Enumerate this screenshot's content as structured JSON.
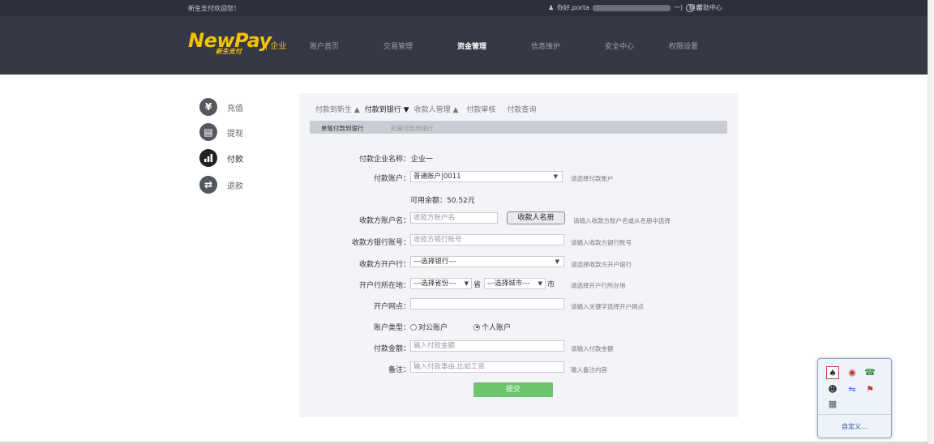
{
  "header": {
    "welcome": "新生支付欢迎您！",
    "greeting": "你好,porta",
    "user_suffix": "一)",
    "logout": "退出",
    "help": "帮助中心",
    "logo_text": "NewPay",
    "logo_sub": "新生支付",
    "enterprise": "| 企业",
    "nav": [
      "账户首页",
      "交易管理",
      "资金管理",
      "信息维护",
      "安全中心",
      "权限设置"
    ],
    "active_nav": "资金管理"
  },
  "sidebar": {
    "items": [
      {
        "label": "充值",
        "icon": "yen-icon"
      },
      {
        "label": "提现",
        "icon": "withdraw-icon"
      },
      {
        "label": "付款",
        "icon": "bar-chart-icon"
      },
      {
        "label": "退款",
        "icon": "refund-icon"
      }
    ],
    "active": "付款"
  },
  "tabs": {
    "items": [
      "付款到新生 ▲",
      "付款到银行 ▼",
      "收款人管理 ▲",
      "付款审核",
      "付款查询"
    ],
    "active": "付款到银行 ▼"
  },
  "subtabs": {
    "single": "单笔付款到银行",
    "batch": "批量付款到银行"
  },
  "form": {
    "company_label": "付款企业名称：",
    "company_value": "企业一",
    "account_label": "付款账户：",
    "account_value": "普通账户|0011",
    "account_hint": "请选择付款账户",
    "balance_label": "可用余额：",
    "balance_value": "50.52元",
    "payee_name_label": "收款方账户名：",
    "payee_name_placeholder": "收款方账户名",
    "payee_book_button": "收款人名册",
    "payee_name_hint": "请输入收款方账户名或从名册中选择",
    "bank_acct_label": "收款方银行账号：",
    "bank_acct_placeholder": "收款方银行账号",
    "bank_acct_hint": "请输入收款方银行账号",
    "bank_label": "收款方开户行：",
    "bank_value": "---选择银行---",
    "bank_hint": "请选择收款方开户银行",
    "location_label": "开户行所在地：",
    "province_value": "---选择省份---",
    "province_unit": "省",
    "city_value": "---选择城市---",
    "city_unit": "市",
    "location_hint": "请选择开户行所在地",
    "branch_label": "开户网点：",
    "branch_hint": "请输入关键字选择开户网点",
    "acct_type_label": "账户类型：",
    "acct_type_public": "对公账户",
    "acct_type_private": "个人账户",
    "amount_label": "付款金额：",
    "amount_placeholder": "输入付款金额",
    "amount_hint": "请输入付款金额",
    "memo_label": "备注：",
    "memo_placeholder": "输入付款事由,比如工资",
    "memo_hint": "输入备注内容",
    "submit": "提交"
  },
  "tray": {
    "customize": "自定义..."
  },
  "colors": {
    "header_bg": "#353845",
    "logo": "#f4c200",
    "submit": "#6cc46b",
    "panel_bg": "#f3f4f8"
  }
}
